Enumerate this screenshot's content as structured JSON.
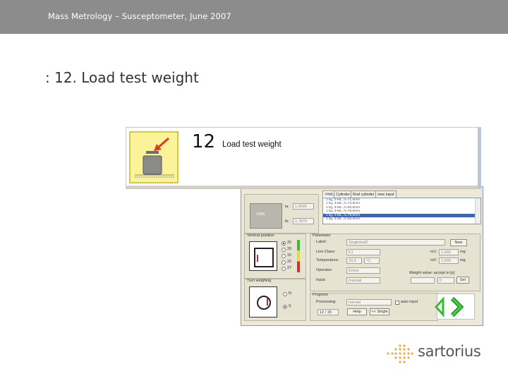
{
  "slide": {
    "header_title": "Mass Metrology – Susceptometer, June 2007",
    "heading": ": 12. Load test weight"
  },
  "step": {
    "number": "12",
    "label": "Load test weight"
  },
  "dialog": {
    "weight_panel": {
      "label_a": "la:",
      "value_a": "1,9926",
      "label_b": "lb:",
      "value_b": "1,7879",
      "weight_tag": "OIML"
    },
    "tabs": [
      "OIML",
      "Cylinder",
      "Rod cylinder",
      "new input"
    ],
    "list_items": [
      "1 kg, 2-ML, h=71,8mm",
      "1 kg, 3-ML, h=73,8mm",
      "1 kg, 3-ML, h=83,8mm",
      "1 kg, 3-ML, h=76,8mm",
      "1 kg, 3-ML, h=79,8mm",
      "1 kg, 3-ML, h=83,8mm"
    ],
    "vertical_position": {
      "title": "Vertical position",
      "options": [
        "25",
        "20",
        "15",
        "22",
        "27"
      ]
    },
    "turn_weighing": {
      "title": "Turn weighing",
      "options": [
        "N",
        "S"
      ]
    },
    "parameter": {
      "title": "Parameter",
      "label_caption": "Label:",
      "label_value": "Singletest2",
      "label_button": "New",
      "line_caption": "Line Class:",
      "line_value": "E1",
      "temp_caption": "Temperature:",
      "temp_value": "20,0",
      "temp_unit": "°C",
      "operator_caption": "Operator:",
      "operator_value": "Ernne",
      "input_caption": "Input:",
      "input_value": "manual",
      "m1_caption": "m1:",
      "m1_value": "1,000",
      "m1_unit": "mg",
      "m2_caption": "m2:",
      "m2_value": "1,000",
      "m2_unit": "mg",
      "weight_caption": "Weight value: accept in [s]",
      "weight_value": "0",
      "weight_button": "Set"
    },
    "progress": {
      "title": "Progress",
      "processing_caption": "Processing:",
      "processing_value": "normal",
      "auto_caption": "auto input",
      "counter": "12 / 15",
      "help_button": "Help",
      "single_button": "<< Single"
    }
  },
  "logo": {
    "brand": "sartorius"
  },
  "colors": {
    "top_bar": "#8c8c8c",
    "icon_box": "#fbf39a",
    "arrow": "#e03a1e",
    "nav_arrow": "#2fbf2a",
    "logo_dots": "#f0a840",
    "list_selection": "#316ac5"
  },
  "icons": {
    "step_icon": "weight-with-arrow-icon",
    "next": "next-arrow-icon",
    "back": "back-arrow-icon"
  }
}
